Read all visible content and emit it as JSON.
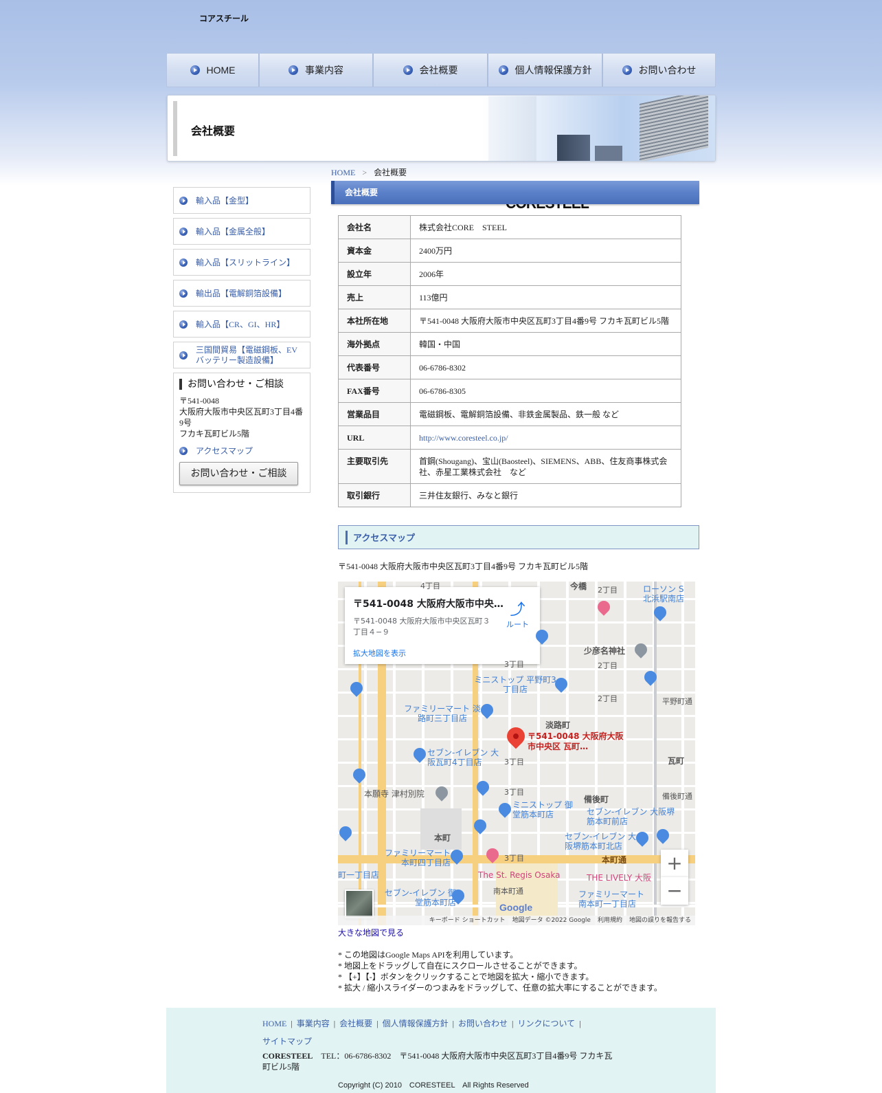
{
  "header": {
    "logo_main": "CORESTEEL",
    "logo_sub": "コアスチール"
  },
  "nav": [
    {
      "label": "HOME"
    },
    {
      "label": "事業内容"
    },
    {
      "label": "会社概要"
    },
    {
      "label": "個人情報保護方針"
    },
    {
      "label": "お問い合わせ"
    }
  ],
  "banner": {
    "title": "会社概要"
  },
  "breadcrumb": {
    "home": "HOME",
    "sep": ">",
    "current": "会社概要"
  },
  "sidebar": {
    "items": [
      {
        "label": "輸入品【金型】"
      },
      {
        "label": "輸入品【金属全般】"
      },
      {
        "label": "輸入品【スリットライン】"
      },
      {
        "label": "輸出品【電解銅箔設備】"
      },
      {
        "label": "輸入品【CR、GI、HR】"
      },
      {
        "label": "三国間貿易【電磁鋼板、EV バッテリー製造設備】"
      }
    ],
    "contact": {
      "title": "お問い合わせ・ご相談",
      "zip": "〒541-0048",
      "address": "大阪府大阪市中央区瓦町3丁目4番9号",
      "building": "フカキ瓦町ビル5階",
      "map_link": "アクセスマップ",
      "button": "お問い合わせ・ご相談"
    }
  },
  "main": {
    "heading": "会社概要",
    "table": [
      {
        "label": "会社名",
        "value": "株式会社CORE　STEEL"
      },
      {
        "label": "資本金",
        "value": "2400万円"
      },
      {
        "label": "設立年",
        "value": "2006年"
      },
      {
        "label": "売上",
        "value": "113億円"
      },
      {
        "label": "本社所在地",
        "value": "〒541-0048 大阪府大阪市中央区瓦町3丁目4番9号 フカキ瓦町ビル5階"
      },
      {
        "label": "海外拠点",
        "value": "韓国・中国"
      },
      {
        "label": "代表番号",
        "value": "06-6786-8302"
      },
      {
        "label": "FAX番号",
        "value": "06-6786-8305"
      },
      {
        "label": "営業品目",
        "value": "電磁鋼板、電解銅箔設備、非鉄金属製品、鉄一般 など"
      },
      {
        "label": "URL",
        "value": "http://www.coresteel.co.jp/"
      },
      {
        "label": "主要取引先",
        "value": "首鋼(Shougang)、宝山(Baosteel)、SIEMENS、ABB、住友商事株式会社、赤星工業株式会社　など"
      },
      {
        "label": "取引銀行",
        "value": "三井住友銀行、みなと銀行"
      }
    ],
    "access_heading": "アクセスマップ",
    "access_address": "〒541-0048 大阪府大阪市中央区瓦町3丁目4番9号 フカキ瓦町ビル5階",
    "map": {
      "card_title": "〒541-0048 大阪府大阪市中央…",
      "card_desc": "〒541-0048 大阪府大阪市中央区瓦町３丁目４−９",
      "card_expand": "拡大地図を表示",
      "card_route": "ルート",
      "pin_label": "〒541-0048 大阪府大阪市中央区 瓦町…",
      "labels": {
        "imabashi": "今橋",
        "lawson": "ローソン S 北浜駅南店",
        "sukunahiko": "少彦名神社",
        "ministop_hirano": "ミニストップ 平野町3丁目店",
        "famima_awaji": "ファミリーマート 淡路町三丁目店",
        "awajimachi": "淡路町",
        "seven_kawara": "セブン-イレブン 大阪瓦町4丁目店",
        "kawaramachi": "瓦町",
        "honganji": "本願寺 津村別院",
        "bingomachi": "備後町",
        "ministop_mido": "ミニストップ 御堂筋本町店",
        "seven_sakai": "セブン-イレブン 大阪堺筋本町北店",
        "seven_sakai2": "セブン-イレブン 大阪堺筋本町前店",
        "honmachi": "本町",
        "famima_honmachi4": "ファミリーマート 本町四丁目店",
        "honmachidori": "本町通",
        "stregis": "The St. Regis Osaka",
        "lively": "THE LIVELY 大阪",
        "seven_mido": "セブン-イレブン 御堂筋本町店",
        "minamihonmachi": "南本町通",
        "famima_minami": "ファミリーマート 南本町一丁目店",
        "hiranomachi": "平野町通",
        "bingodori": "備後町通",
        "chome2a": "2丁目",
        "chome2b": "2丁目",
        "chome2c": "2丁目",
        "chome3a": "3丁目",
        "chome3b": "3丁目",
        "chome3c": "3丁目",
        "chome3d": "3丁目",
        "chome4": "4丁目",
        "icchome": "町一丁目店"
      },
      "attrib": [
        "キーボード ショートカット",
        "地図データ ©2022 Google",
        "利用規約",
        "地図の誤りを報告する"
      ],
      "google": "Google",
      "zoom_in": "+",
      "zoom_out": "−"
    },
    "big_map_link": "大きな地図で見る",
    "notes": [
      "* この地図はGoogle Maps APIを利用しています。",
      "* 地図上をドラッグして自在にスクロールさせることができます。",
      "* 【+】【-】ボタンをクリックすることで地図を拡大・縮小できます。",
      "* 拡大 / 縮小スライダーのつまみをドラッグして、任意の拡大率にすることができます。"
    ]
  },
  "footer": {
    "links": [
      "HOME",
      "事業内容",
      "会社概要",
      "個人情報保護方針",
      "お問い合わせ",
      "リンクについて",
      "サイトマップ"
    ],
    "company": "CORESTEEL",
    "info": "TEL：06-6786-8302　〒541-0048 大阪府大阪市中央区瓦町3丁目4番9号 フカキ瓦町ビル5階",
    "copyright": "Copyright (C) 2010　CORESTEEL　All Rights Reserved"
  },
  "colors": {
    "accent": "#4a70bb",
    "link": "#3a5fa8",
    "footer_bg": "#e2f3f4"
  }
}
